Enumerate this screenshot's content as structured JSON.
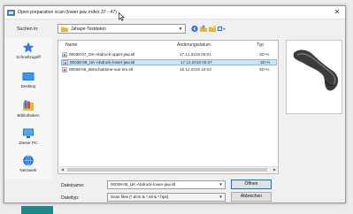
{
  "window": {
    "title": "Open preparation scan (lower jaw, index 37 - 47)"
  },
  "lookin": {
    "label": "Suchen in:",
    "value": "Jahape-Testdaten"
  },
  "places": [
    {
      "label": "Schnellzugriff",
      "icon": "star-icon"
    },
    {
      "label": "Desktop",
      "icon": "desktop-icon"
    },
    {
      "label": "Bibliotheken",
      "icon": "libraries-icon"
    },
    {
      "label": "Dieser PC",
      "icon": "computer-icon"
    },
    {
      "label": "Netzwerk",
      "icon": "network-icon"
    }
  ],
  "filelist": {
    "columns": [
      "Name",
      "Änderungsdatum",
      "Typ"
    ],
    "rows": [
      {
        "name": "00038-07_OK-Abdruck-upper-jaw.stl",
        "date": "17.12.2019 09:01",
        "type": "3D-%",
        "selected": false
      },
      {
        "name": "00038-08_UK-Abdruck-lower-jaw.stl",
        "date": "17.12.2019 09:37",
        "type": "3D-%",
        "selected": true
      },
      {
        "name": "00038-09_Bisschablone-vue-rim.stl",
        "date": "18.12.2019 16:03",
        "type": "3D-%",
        "selected": false
      }
    ]
  },
  "filename": {
    "label": "Dateiname:",
    "value": "00038-08_UK-Abdruck-lower-jaw.stl"
  },
  "filetype": {
    "label": "Dateityp:",
    "value": "Scan files (*.dcm & *.stl & *.hps)"
  },
  "buttons": {
    "open": "Öffnen",
    "cancel": "Abbrechen"
  },
  "colors": {
    "selection": "#cce4f7",
    "accent": "#0078d7",
    "folder": "#e8b73a",
    "taskbar_tab": "#1a8a86"
  }
}
